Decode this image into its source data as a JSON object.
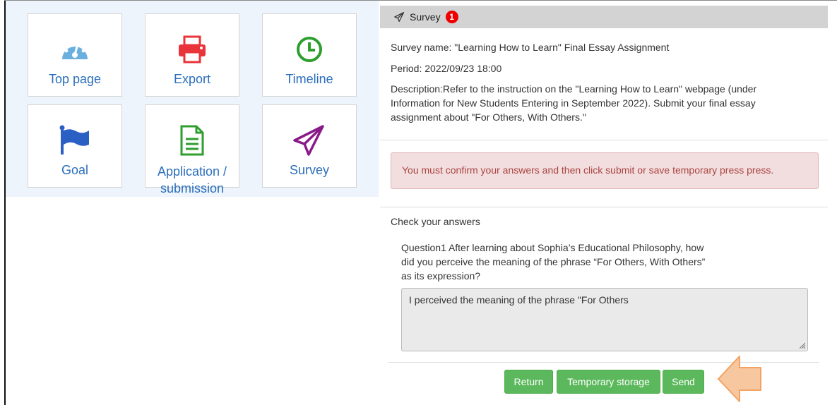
{
  "tiles": [
    {
      "label": "Top page",
      "icon": "dashboard-icon"
    },
    {
      "label": "Export",
      "icon": "printer-icon"
    },
    {
      "label": "Timeline",
      "icon": "clock-icon"
    },
    {
      "label": "Goal",
      "icon": "flag-icon"
    },
    {
      "label": "Application / submission",
      "icon": "document-icon"
    },
    {
      "label": "Survey",
      "icon": "paper-plane-icon"
    }
  ],
  "survey": {
    "header_title": "Survey",
    "badge_count": "1",
    "name": "Survey name: \"Learning How to Learn\" Final Essay Assignment",
    "period": "Period: 2022/09/23 18:00",
    "description": "Description:Refer to the instruction on the \"Learning How to Learn\" webpage (under Information for New Students Entering in September 2022). Submit your final essay assignment about \"For Others, With Others.\"",
    "alert": "You must confirm your answers and then click submit or save temporary press press.",
    "check_heading": "Check your answers",
    "question": "Question1 After learning about Sophia’s Educational Philosophy, how did you perceive the meaning of the phrase “For Others, With Others” as its expression?",
    "answer": "I perceived the meaning of the phrase \"For Others"
  },
  "buttons": {
    "return_label": "Return",
    "temporary_label": "Temporary storage",
    "send_label": "Send"
  },
  "colors": {
    "tile_label": "#2a6ebb",
    "alert_bg": "#f2dede",
    "alert_text": "#a94442",
    "button_green": "#5cb85c",
    "badge_red": "#ee0000",
    "arrow_orange": "#f7c7a0"
  }
}
